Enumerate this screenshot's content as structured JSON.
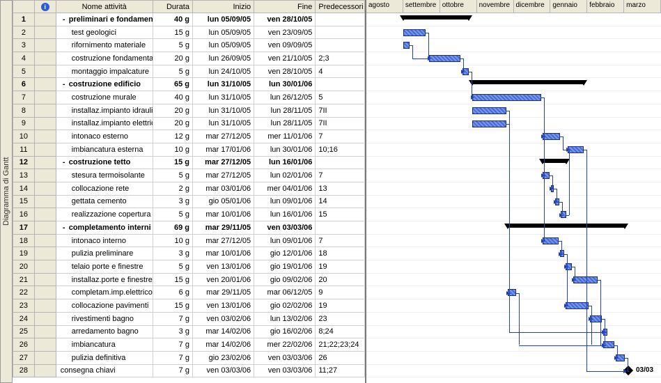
{
  "sidebar_label": "Diagramma di Gantt",
  "columns": {
    "info_icon": "i",
    "name": "Nome attività",
    "duration": "Durata",
    "start": "Inizio",
    "end": "Fine",
    "predecessors": "Predecessori"
  },
  "timescale": [
    "agosto",
    "settembre",
    "ottobre",
    "novembre",
    "dicembre",
    "gennaio",
    "febbraio",
    "marzo"
  ],
  "tasks": [
    {
      "id": 1,
      "name": "preliminari e fondamenta",
      "dur": "40 g",
      "start": "lun 05/09/05",
      "end": "ven 28/10/05",
      "pred": "",
      "summary": true,
      "barStart": 53,
      "barEnd": 147
    },
    {
      "id": 2,
      "name": "test geologici",
      "dur": "15 g",
      "start": "lun 05/09/05",
      "end": "ven 23/09/05",
      "pred": "",
      "indent": 1,
      "barStart": 53,
      "barEnd": 85
    },
    {
      "id": 3,
      "name": "rifornimento materiale",
      "dur": "5 g",
      "start": "lun 05/09/05",
      "end": "ven 09/09/05",
      "pred": "",
      "indent": 1,
      "barStart": 53,
      "barEnd": 62
    },
    {
      "id": 4,
      "name": "costruzione fondamenta",
      "dur": "20 g",
      "start": "lun 26/09/05",
      "end": "ven 21/10/05",
      "pred": "2;3",
      "indent": 1,
      "barStart": 90,
      "barEnd": 135
    },
    {
      "id": 5,
      "name": "montaggio impalcature",
      "dur": "5 g",
      "start": "lun 24/10/05",
      "end": "ven 28/10/05",
      "pred": "4",
      "indent": 1,
      "barStart": 138,
      "barEnd": 147
    },
    {
      "id": 6,
      "name": "costruzione edificio",
      "dur": "65 g",
      "start": "lun 31/10/05",
      "end": "lun 30/01/06",
      "pred": "",
      "summary": true,
      "barStart": 152,
      "barEnd": 312
    },
    {
      "id": 7,
      "name": "costruzione murale",
      "dur": "40 g",
      "start": "lun 31/10/05",
      "end": "lun 26/12/05",
      "pred": "5",
      "indent": 1,
      "barStart": 152,
      "barEnd": 251
    },
    {
      "id": 8,
      "name": "installaz.impianto idraulico",
      "dur": "20 g",
      "start": "lun 31/10/05",
      "end": "lun 28/11/05",
      "pred": "7II",
      "indent": 1,
      "barStart": 152,
      "barEnd": 201
    },
    {
      "id": 9,
      "name": "installaz.impianto elettrico",
      "dur": "20 g",
      "start": "lun 31/10/05",
      "end": "lun 28/11/05",
      "pred": "7II",
      "indent": 1,
      "barStart": 152,
      "barEnd": 201
    },
    {
      "id": 10,
      "name": "intonaco esterno",
      "dur": "12 g",
      "start": "mar 27/12/05",
      "end": "mer 11/01/06",
      "pred": "7",
      "indent": 1,
      "barStart": 253,
      "barEnd": 278
    },
    {
      "id": 11,
      "name": "imbiancatura esterna",
      "dur": "10 g",
      "start": "mar 17/01/06",
      "end": "lun 30/01/06",
      "pred": "10;16",
      "indent": 1,
      "barStart": 289,
      "barEnd": 312
    },
    {
      "id": 12,
      "name": "costruzione tetto",
      "dur": "15 g",
      "start": "mar 27/12/05",
      "end": "lun 16/01/06",
      "pred": "",
      "summary": true,
      "barStart": 253,
      "barEnd": 287
    },
    {
      "id": 13,
      "name": "stesura termoisolante",
      "dur": "5 g",
      "start": "mar 27/12/05",
      "end": "lun 02/01/06",
      "pred": "7",
      "indent": 1,
      "barStart": 253,
      "barEnd": 263
    },
    {
      "id": 14,
      "name": "collocazione rete",
      "dur": "2 g",
      "start": "mar 03/01/06",
      "end": "mer 04/01/06",
      "pred": "13",
      "indent": 1,
      "barStart": 265,
      "barEnd": 269
    },
    {
      "id": 15,
      "name": "gettata cemento",
      "dur": "3 g",
      "start": "gio 05/01/06",
      "end": "lun 09/01/06",
      "pred": "14",
      "indent": 1,
      "barStart": 271,
      "barEnd": 277
    },
    {
      "id": 16,
      "name": "realizzazione copertura",
      "dur": "5 g",
      "start": "mar 10/01/06",
      "end": "lun 16/01/06",
      "pred": "15",
      "indent": 1,
      "barStart": 279,
      "barEnd": 287
    },
    {
      "id": 17,
      "name": "completamento interni",
      "dur": "69 g",
      "start": "mar 29/11/05",
      "end": "ven 03/03/06",
      "pred": "",
      "summary": true,
      "barStart": 203,
      "barEnd": 371
    },
    {
      "id": 18,
      "name": "intonaco interno",
      "dur": "10 g",
      "start": "mar 27/12/05",
      "end": "lun 09/01/06",
      "pred": "7",
      "indent": 1,
      "barStart": 253,
      "barEnd": 276
    },
    {
      "id": 19,
      "name": "pulizia preliminare",
      "dur": "3 g",
      "start": "mar 10/01/06",
      "end": "gio 12/01/06",
      "pred": "18",
      "indent": 1,
      "barStart": 278,
      "barEnd": 284
    },
    {
      "id": 20,
      "name": "telaio porte e finestre",
      "dur": "5 g",
      "start": "ven 13/01/06",
      "end": "gio 19/01/06",
      "pred": "19",
      "indent": 1,
      "barStart": 286,
      "barEnd": 295
    },
    {
      "id": 21,
      "name": "installaz.porte e finestre",
      "dur": "15 g",
      "start": "ven 20/01/06",
      "end": "gio 09/02/06",
      "pred": "20",
      "indent": 1,
      "barStart": 297,
      "barEnd": 332
    },
    {
      "id": 22,
      "name": "completam.imp.elettrico",
      "dur": "6 g",
      "start": "mar 29/11/05",
      "end": "mar 06/12/05",
      "pred": "9",
      "indent": 1,
      "barStart": 203,
      "barEnd": 215
    },
    {
      "id": 23,
      "name": "collocazione pavimenti",
      "dur": "15 g",
      "start": "ven 13/01/06",
      "end": "gio 02/02/06",
      "pred": "19",
      "indent": 1,
      "barStart": 286,
      "barEnd": 319
    },
    {
      "id": 24,
      "name": "rivestimenti bagno",
      "dur": "7 g",
      "start": "ven 03/02/06",
      "end": "lun 13/02/06",
      "pred": "23",
      "indent": 1,
      "barStart": 321,
      "barEnd": 338
    },
    {
      "id": 25,
      "name": "arredamento bagno",
      "dur": "3 g",
      "start": "mar 14/02/06",
      "end": "gio 16/02/06",
      "pred": "8;24",
      "indent": 1,
      "barStart": 340,
      "barEnd": 346
    },
    {
      "id": 26,
      "name": "imbiancatura",
      "dur": "7 g",
      "start": "mar 14/02/06",
      "end": "mer 22/02/06",
      "pred": "21;22;23;24",
      "indent": 1,
      "barStart": 340,
      "barEnd": 356
    },
    {
      "id": 27,
      "name": "pulizia definitiva",
      "dur": "7 g",
      "start": "gio 23/02/06",
      "end": "ven 03/03/06",
      "pred": "26",
      "indent": 1,
      "barStart": 358,
      "barEnd": 371
    },
    {
      "id": 28,
      "name": "consegna chiavi",
      "dur": "7 g",
      "start": "ven 03/03/06",
      "end": "ven 03/03/06",
      "pred": "11;27",
      "milestone": true,
      "msLabel": "03/03",
      "barStart": 371
    }
  ]
}
